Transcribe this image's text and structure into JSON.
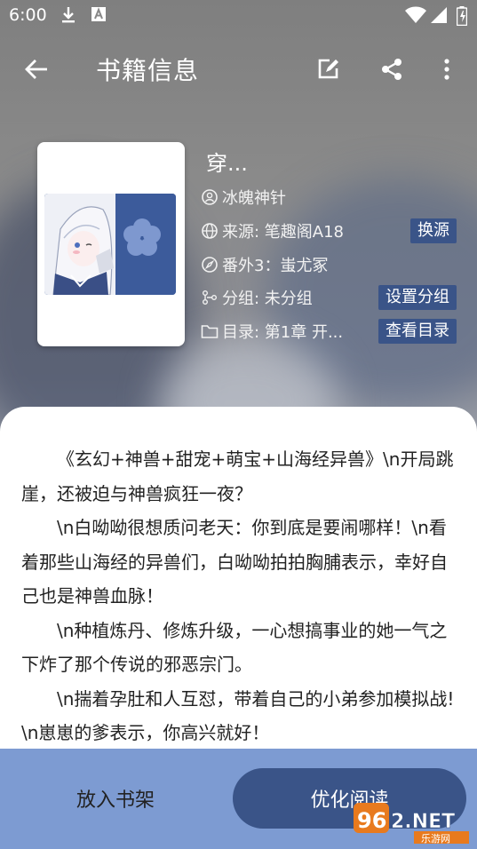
{
  "status_bar": {
    "time": "6:00",
    "icons": [
      "download-icon",
      "a-icon",
      "wifi-icon",
      "signal-icon",
      "battery-icon"
    ]
  },
  "app_bar": {
    "title": "书籍信息",
    "icons": [
      "back-arrow-icon",
      "edit-icon",
      "share-icon",
      "more-vert-icon"
    ]
  },
  "book": {
    "title": "穿...",
    "author": "冰魄神针",
    "source": "来源: 笔趣阁A18",
    "source_button": "换源",
    "latest": "番外3：蚩尤冢",
    "group": "分组: 未分组",
    "group_button": "设置分组",
    "toc": "目录: 第1章 开...",
    "toc_button": "查看目录"
  },
  "description": [
    "《玄幻+神兽+甜宠+萌宝+山海经异兽》\\n开局跳崖，还被迫与神兽疯狂一夜？",
    "\\n白呦呦很想质问老天：你到底是要闹哪样！\\n看着那些山海经的异兽们，白呦呦拍拍胸脯表示，幸好自己也是神兽血脉！",
    "\\n种植炼丹、修炼升级，一心想搞事业的她一气之下炸了那个传说的邪恶宗门。",
    "\\n揣着孕肚和人互怼，带着自己的小弟参加模拟战!\\n崽崽的爹表示，你高兴就好！"
  ],
  "actions": {
    "add_to_shelf": "放入书架",
    "start_reading": "优化阅读"
  },
  "watermark": {
    "brand": "962.NET",
    "sub": "乐游网"
  },
  "colors": {
    "accent": "#3a5488",
    "bottom_bar": "#7d9bd2"
  }
}
